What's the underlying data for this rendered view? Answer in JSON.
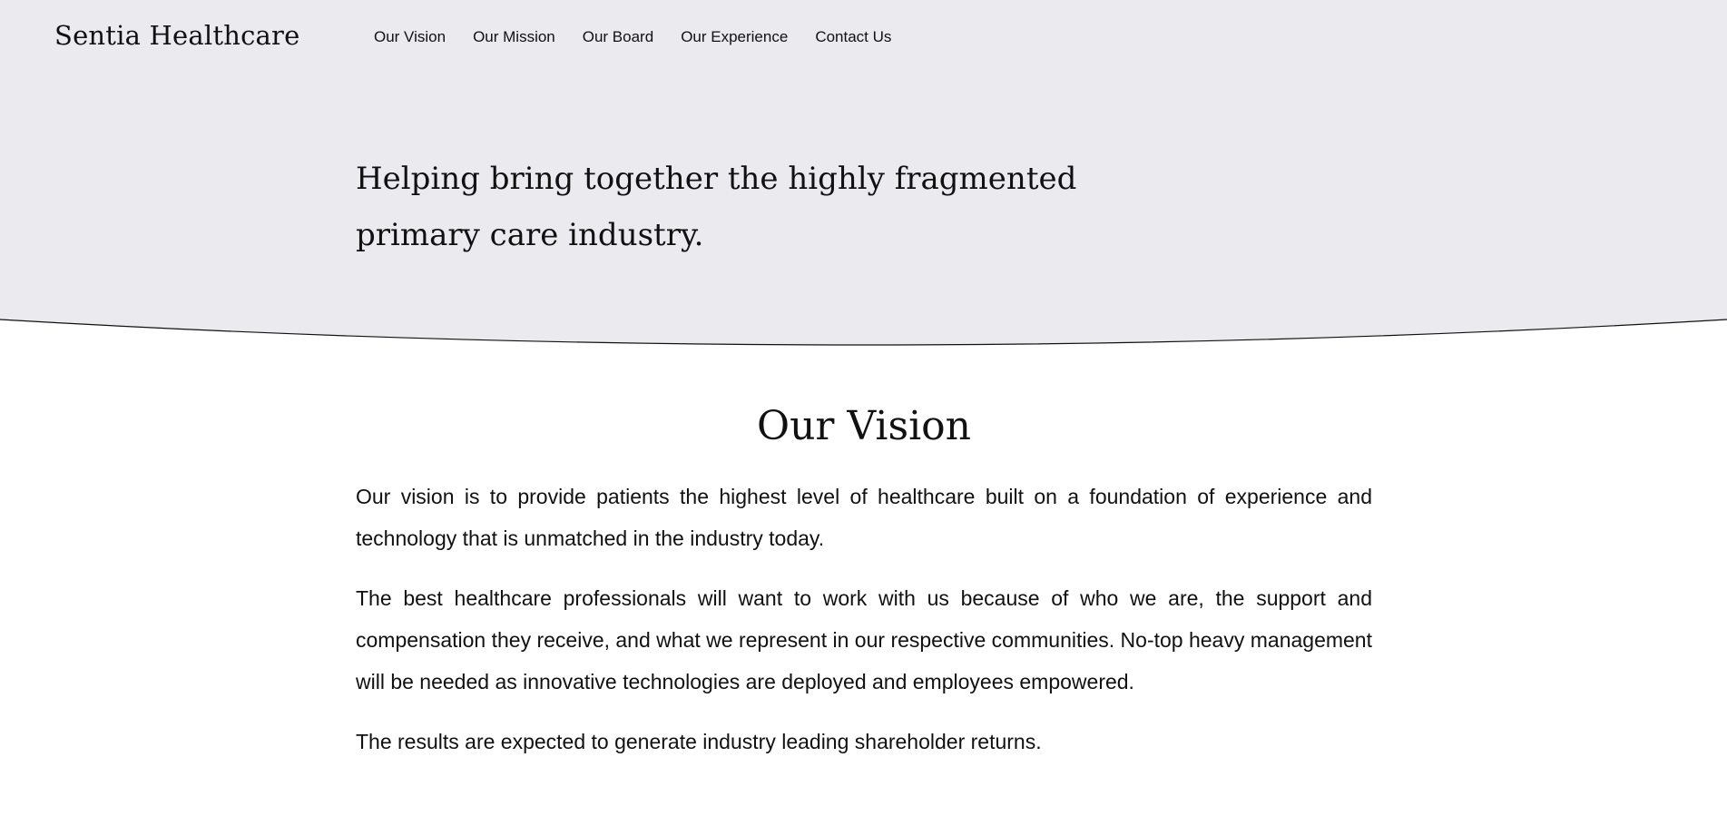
{
  "brand": "Sentia Healthcare",
  "nav": {
    "items": [
      "Our Vision",
      "Our Mission",
      "Our Board",
      "Our Experience",
      "Contact Us"
    ]
  },
  "hero": {
    "tagline_line1": "Helping bring together the highly fragmented",
    "tagline_line2": "primary care industry."
  },
  "vision": {
    "title": "Our Vision",
    "paragraphs": [
      "Our vision is to provide patients the highest level of healthcare built on a foundation of experience and technology that is unmatched in the industry today.",
      "The best healthcare professionals will want to work with us because of who we are, the support and compensation they receive, and what we represent in our respective communities. No-top heavy management will be needed as innovative technologies are deployed and employees empowered.",
      "The results are expected to generate industry leading shareholder returns."
    ]
  },
  "colors": {
    "hero_background": "#ebebef",
    "curve_stroke": "#111111",
    "text": "#111111",
    "page_background": "#ffffff"
  }
}
